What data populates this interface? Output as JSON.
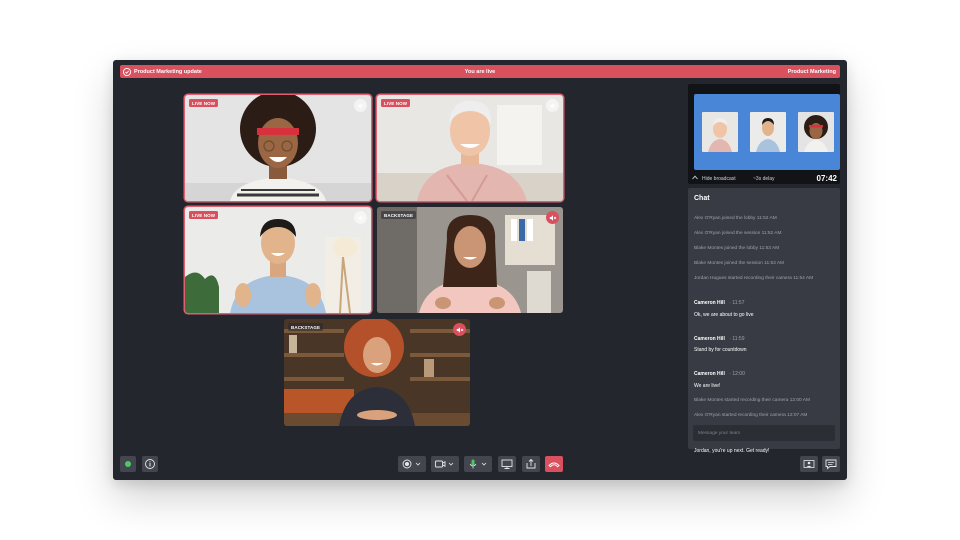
{
  "topbar": {
    "title": "Product Marketing update",
    "status": "You are live",
    "right_label": "Product Marketing",
    "accent": "#d9505f"
  },
  "tiles": [
    {
      "badge": "LIVE NOW"
    },
    {
      "badge": "LIVE NOW"
    },
    {
      "badge": "LIVE NOW"
    },
    {
      "badge": "BACKSTAGE"
    },
    {
      "badge": "BACKSTAGE"
    }
  ],
  "broadcast": {
    "hide_label": "Hide broadcast",
    "delay": "~3s delay",
    "time": "07:42",
    "screen_color": "#4a86d8"
  },
  "chat": {
    "title": "Chat",
    "system": [
      "Alex O'Ryan joined the lobby 11:52 AM",
      "Alex O'Ryan joined the session 11:52 AM",
      "Blake Montes joined the lobby 11:53 AM",
      "Blake Montes joined the session 11:53 AM",
      "Jordan Hugues started recording their camera 11:54 AM",
      "Blake Montes started recording their camera 12:00 AM",
      "Alex O'Ryan started recording their camera 12:07 AM"
    ],
    "messages": [
      {
        "author": "Cameron Hill",
        "time": "· 11:57",
        "text": "Ok, we are about to go live"
      },
      {
        "author": "Cameron Hill",
        "time": "· 11:59",
        "text": "Stand by for countdown"
      },
      {
        "author": "Cameron Hill",
        "time": "· 12:00",
        "text": "We are live!"
      },
      {
        "author": "Cameron Hill",
        "time": "· 12:09",
        "text": "Jordan, you're up next. Get ready!"
      }
    ],
    "input_placeholder": "Message your team"
  }
}
